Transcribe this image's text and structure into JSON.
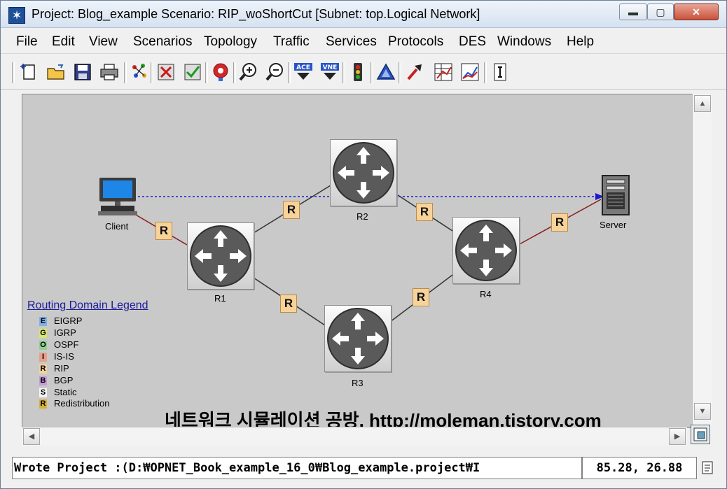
{
  "window": {
    "title": "Project: Blog_example Scenario: RIP_woShortCut  [Subnet: top.Logical Network]",
    "minimize": "▬",
    "restore": "▢",
    "close": "✕"
  },
  "menu": [
    "File",
    "Edit",
    "View",
    "Scenarios",
    "Topology",
    "Traffic",
    "Services",
    "Protocols",
    "DES",
    "Windows",
    "Help"
  ],
  "toolbar": {
    "icons": [
      "new-icon",
      "open-icon",
      "save-icon",
      "print-icon",
      "color-icon",
      "check-links-icon",
      "verify-icon",
      "fail-node-icon",
      "zoom-in-icon",
      "zoom-out-icon",
      "ace-import-icon",
      "vne-import-icon",
      "traffic-light-icon",
      "triangle-icon",
      "configure-run-icon",
      "results-icon",
      "view-graph-icon",
      "info-icon"
    ],
    "ace_label": "ACE",
    "vne_label": "VNE"
  },
  "network": {
    "nodes": {
      "client": "Client",
      "server": "Server",
      "r1": "R1",
      "r2": "R2",
      "r3": "R3",
      "r4": "R4"
    },
    "link_badge": "R"
  },
  "legend": {
    "title": "Routing Domain Legend",
    "items": [
      {
        "key": "E",
        "label": "EIGRP",
        "color": "#7fb1e6"
      },
      {
        "key": "G",
        "label": "IGRP",
        "color": "#d8e86a"
      },
      {
        "key": "O",
        "label": "OSPF",
        "color": "#8fd08f"
      },
      {
        "key": "I",
        "label": "IS-IS",
        "color": "#e7a08a"
      },
      {
        "key": "R",
        "label": "RIP",
        "color": "#f7d39a"
      },
      {
        "key": "B",
        "label": "BGP",
        "color": "#c79ad9"
      },
      {
        "key": "S",
        "label": "Static",
        "color": "#f4f4f4"
      },
      {
        "key": "R",
        "label": "Redistribution",
        "color": "#d9b233"
      }
    ]
  },
  "watermark": "네트워크 시뮬레이션 공방, http://moleman.tistory.com",
  "status": {
    "message": "Wrote Project :(D:₩OPNET_Book_example_16_0₩Blog_example.project₩I",
    "coords": "85.28, 26.88"
  },
  "colors": {
    "link": "#333333",
    "client_server_link": "#8b1a1a",
    "flow": "#1a1ad0",
    "badge": "#f7d39a"
  }
}
